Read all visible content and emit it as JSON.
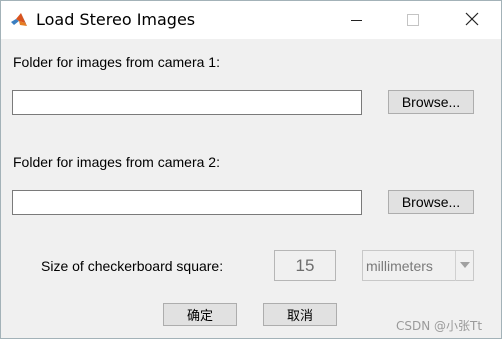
{
  "window": {
    "title": "Load Stereo Images",
    "icon": "matlab-logo-icon",
    "controls": {
      "minimize_icon": "minimize-icon",
      "maximize_icon": "maximize-icon",
      "close_icon": "close-icon"
    }
  },
  "camera1": {
    "label": "Folder for images from camera 1:",
    "value": "",
    "browse_label": "Browse..."
  },
  "camera2": {
    "label": "Folder for images from camera 2:",
    "value": "",
    "browse_label": "Browse..."
  },
  "checkerboard": {
    "label": "Size of checkerboard square:",
    "value": "15",
    "units_selected": "millimeters"
  },
  "actions": {
    "ok_label": "确定",
    "cancel_label": "取消"
  },
  "watermark": "CSDN @小张Tt",
  "colors": {
    "window_bg": "#f0f0f0",
    "titlebar_bg": "#ffffff",
    "button_bg": "#e1e1e1",
    "disabled_text": "#6d6d6d"
  }
}
